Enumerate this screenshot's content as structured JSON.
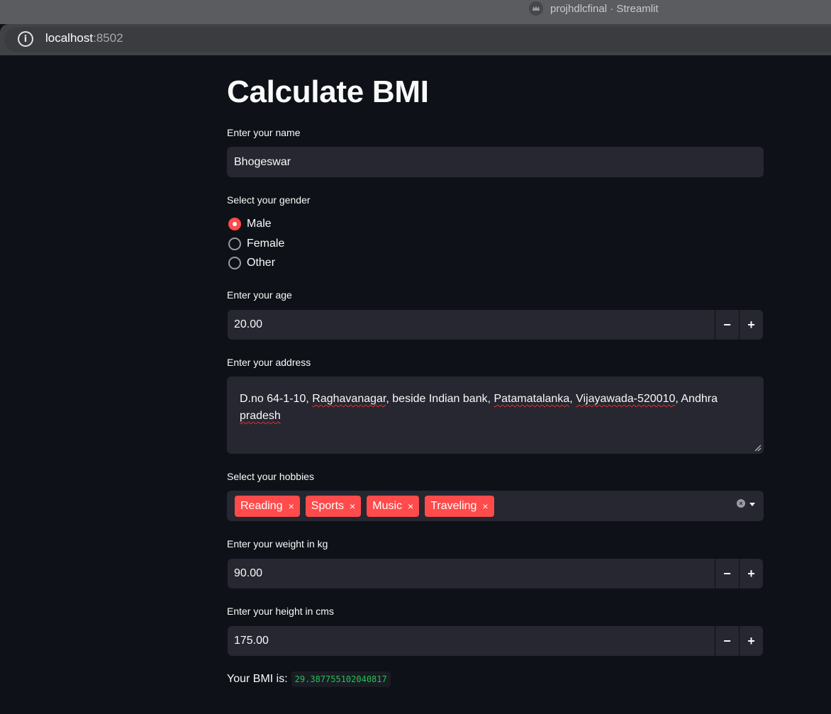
{
  "browser": {
    "tab_title": "projhdlcfinal · Streamlit",
    "url_host": "localhost",
    "url_port": ":8502"
  },
  "page": {
    "title": "Calculate BMI"
  },
  "name_field": {
    "label": "Enter your name",
    "value": "Bhogeswar"
  },
  "gender": {
    "label": "Select your gender",
    "options": [
      "Male",
      "Female",
      "Other"
    ],
    "selected": "Male"
  },
  "age_field": {
    "label": "Enter your age",
    "value": "20.00",
    "minus": "−",
    "plus": "+"
  },
  "address_field": {
    "label": "Enter your address",
    "value_parts": [
      "D.no 64-1-10, ",
      "Raghavanagar",
      ", beside Indian bank, ",
      "Patamatalanka",
      ", ",
      "Vijayawada-520010",
      ", Andhra ",
      "pradesh"
    ]
  },
  "hobbies": {
    "label": "Select your hobbies",
    "selected": [
      "Reading",
      "Sports",
      "Music",
      "Traveling"
    ],
    "remove_glyph": "×"
  },
  "weight_field": {
    "label": "Enter your weight in kg",
    "value": "90.00",
    "minus": "−",
    "plus": "+"
  },
  "height_field": {
    "label": "Enter your height in cms",
    "value": "175.00",
    "minus": "−",
    "plus": "+"
  },
  "result": {
    "label": "Your BMI is:",
    "value": "29.387755102040817"
  },
  "colors": {
    "background": "#0e1117",
    "widget": "#262730",
    "accent": "#ff4b4b",
    "code_text": "#21c354"
  }
}
